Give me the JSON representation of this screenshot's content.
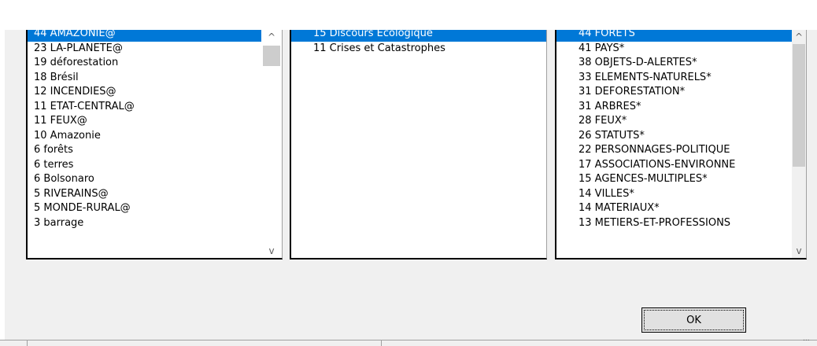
{
  "lists": [
    {
      "items": [
        "44 AMAZONIE@",
        "23 LA-PLANETE@",
        "19 déforestation",
        "18 Brésil",
        "12 INCENDIES@",
        "11 ETAT-CENTRAL@",
        "11 FEUX@",
        "10 Amazonie",
        " 6 forêts",
        " 6 terres",
        " 6 Bolsonaro",
        " 5 RIVERAINS@",
        " 5 MONDE-RURAL@",
        " 3 barrage"
      ],
      "selected_index": 0
    },
    {
      "items": [
        "15 Discours Ecologique",
        "11 Crises et Catastrophes"
      ],
      "selected_index": 0
    },
    {
      "items": [
        "44 FORETS",
        "41 PAYS*",
        "38 OBJETS-D-ALERTES*",
        "33 ELEMENTS-NATURELS*",
        "31 DEFORESTATION*",
        "31 ARBRES*",
        "28 FEUX*",
        "26 STATUTS*",
        "22 PERSONNAGES-POLITIQUE",
        "17 ASSOCIATIONS-ENVIRONNE",
        "15 AGENCES-MULTIPLES*",
        "14 VILLES*",
        "14 MATERIAUX*",
        "13 METIERS-ET-PROFESSIONS"
      ],
      "selected_index": 0
    }
  ],
  "ok_button": {
    "label": "OK"
  },
  "icons": {
    "scroll_up": "chevron-up-icon",
    "scroll_down": "chevron-down-icon"
  },
  "colors": {
    "selection": "#0078d7",
    "window": "#f0f0f0"
  }
}
